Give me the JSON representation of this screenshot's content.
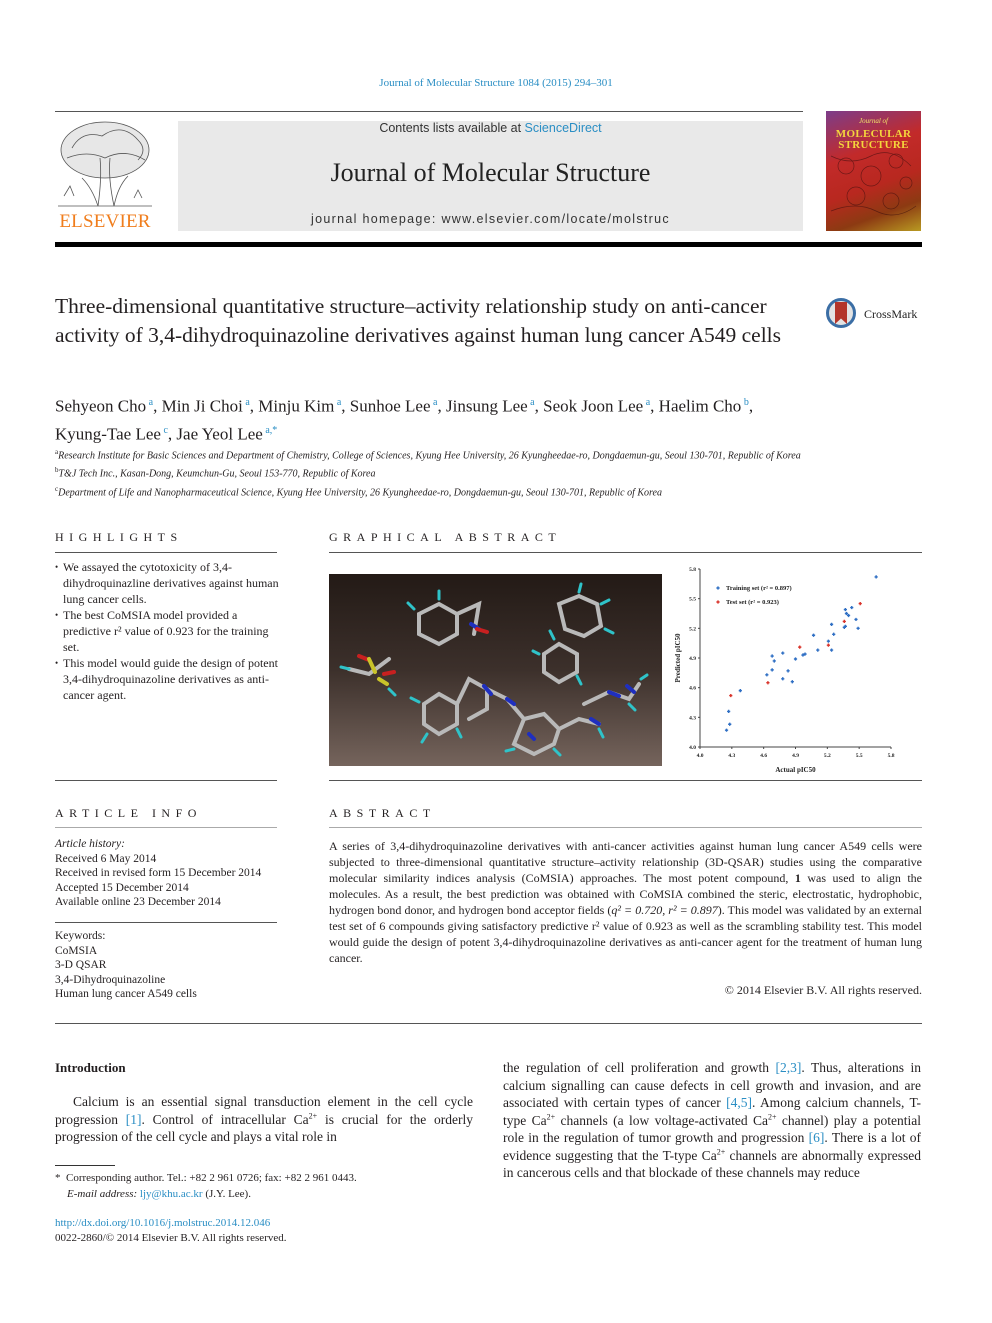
{
  "header": {
    "journal_ref": "Journal of Molecular Structure 1084 (2015) 294–301",
    "contents_prefix": "Contents lists available at ",
    "contents_link": "ScienceDirect",
    "journal_title": "Journal of Molecular Structure",
    "homepage": "journal homepage: www.elsevier.com/locate/molstruc",
    "publisher_logo": "ELSEVIER",
    "cover_line1": "Journal of",
    "cover_line2": "MOLECULAR",
    "cover_line3": "STRUCTURE"
  },
  "article": {
    "title": "Three-dimensional quantitative structure–activity relationship study on anti-cancer activity of 3,4-dihydroquinazoline derivatives against human lung cancer A549 cells",
    "crossmark_label": "CrossMark",
    "authors": [
      {
        "name": "Sehyeon Cho",
        "aff": "a"
      },
      {
        "name": "Min Ji Choi",
        "aff": "a"
      },
      {
        "name": "Minju Kim",
        "aff": "a"
      },
      {
        "name": "Sunhoe Lee",
        "aff": "a"
      },
      {
        "name": "Jinsung Lee",
        "aff": "a"
      },
      {
        "name": "Seok Joon Lee",
        "aff": "a"
      },
      {
        "name": "Haelim Cho",
        "aff": "b"
      },
      {
        "name": "Kyung-Tae Lee",
        "aff": "c"
      },
      {
        "name": "Jae Yeol Lee",
        "aff": "a,*"
      }
    ],
    "affiliations": [
      {
        "key": "a",
        "text": "Research Institute for Basic Sciences and Department of Chemistry, College of Sciences, Kyung Hee University, 26 Kyungheedae-ro, Dongdaemun-gu, Seoul 130-701, Republic of Korea"
      },
      {
        "key": "b",
        "text": "T&J Tech Inc., Kasan-Dong, Keumchun-Gu, Seoul 153-770, Republic of Korea"
      },
      {
        "key": "c",
        "text": "Department of Life and Nanopharmaceutical Science, Kyung Hee University, 26 Kyungheedae-ro, Dongdaemun-gu, Seoul 130-701, Republic of Korea"
      }
    ]
  },
  "highlights": {
    "heading": "HIGHLIGHTS",
    "items": [
      "We assayed the cytotoxicity of 3,4-dihydroquinazline derivatives against human lung cancer cells.",
      "The best CoMSIA model provided a predictive r² value of 0.923 for the training set.",
      "This model would guide the design of potent 3,4-dihydroquinazoline derivatives as anti-cancer agent."
    ]
  },
  "graphical_abstract": {
    "heading": "GRAPHICAL ABSTRACT",
    "image_alt": "3D molecular alignment of 3,4-dihydroquinazoline derivatives"
  },
  "chart_data": {
    "type": "scatter",
    "title": "",
    "xlabel": "Actual pIC50",
    "ylabel": "Predicted pIC50",
    "xlim": [
      4.0,
      5.8
    ],
    "ylim": [
      4.0,
      5.8
    ],
    "xticks": [
      "4.0",
      "4.3",
      "4.6",
      "4.9",
      "5.2",
      "5.5",
      "5.8"
    ],
    "yticks": [
      "4.0",
      "4.3",
      "4.6",
      "4.9",
      "5.2",
      "5.5",
      "5.8"
    ],
    "grid": false,
    "legend_position": "top-left",
    "series": [
      {
        "name": "Training set (r² = 0.897)",
        "color": "#2f6fc4",
        "points": [
          [
            4.25,
            4.17
          ],
          [
            4.27,
            4.36
          ],
          [
            4.28,
            4.23
          ],
          [
            4.38,
            4.57
          ],
          [
            4.63,
            4.73
          ],
          [
            4.68,
            4.78
          ],
          [
            4.68,
            4.92
          ],
          [
            4.7,
            4.87
          ],
          [
            4.78,
            4.95
          ],
          [
            4.78,
            4.69
          ],
          [
            4.83,
            4.77
          ],
          [
            4.87,
            4.66
          ],
          [
            4.9,
            4.89
          ],
          [
            4.97,
            4.93
          ],
          [
            4.99,
            4.94
          ],
          [
            5.07,
            5.13
          ],
          [
            5.11,
            4.98
          ],
          [
            5.21,
            5.07
          ],
          [
            5.24,
            4.98
          ],
          [
            5.24,
            5.24
          ],
          [
            5.26,
            5.14
          ],
          [
            5.36,
            5.21
          ],
          [
            5.37,
            5.22
          ],
          [
            5.37,
            5.39
          ],
          [
            5.38,
            5.35
          ],
          [
            5.4,
            5.33
          ],
          [
            5.43,
            5.41
          ],
          [
            5.47,
            5.29
          ],
          [
            5.49,
            5.2
          ],
          [
            5.66,
            5.72
          ]
        ]
      },
      {
        "name": "Test set (r² = 0.923)",
        "color": "#d9342b",
        "points": [
          [
            4.29,
            4.52
          ],
          [
            4.64,
            4.65
          ],
          [
            4.94,
            5.01
          ],
          [
            5.21,
            5.03
          ],
          [
            5.36,
            5.27
          ],
          [
            5.51,
            5.45
          ]
        ]
      }
    ]
  },
  "article_info": {
    "heading": "ARTICLE INFO",
    "history_label": "Article history:",
    "history": [
      "Received 6 May 2014",
      "Received in revised form 15 December 2014",
      "Accepted 15 December 2014",
      "Available online 23 December 2014"
    ],
    "keywords_label": "Keywords:",
    "keywords": [
      "CoMSIA",
      "3-D QSAR",
      "3,4-Dihydroquinazoline",
      "Human lung cancer A549 cells"
    ]
  },
  "abstract": {
    "heading": "ABSTRACT",
    "p1": "A series of 3,4-dihydroquinazoline derivatives with anti-cancer activities against human lung cancer A549 cells were subjected to three-dimensional quantitative structure–activity relationship (3D-QSAR) studies using the comparative molecular similarity indices analysis (CoMSIA) approaches. The most potent compound, ",
    "bold1": "1",
    "p2": " was used to align the molecules. As a result, the best prediction was obtained with CoMSIA combined the steric, electrostatic, hydrophobic, hydrogen bond donor, and hydrogen bond acceptor fields (",
    "q2": "q² = 0.720, r² = 0.897",
    "p3": "). This model was validated by an external test set of 6 compounds giving satisfactory predictive r² value of 0.923 as well as the scrambling stability test. This model would guide the design of potent 3,4-dihydroquinazoline derivatives as anti-cancer agent for the treatment of human lung cancer.",
    "copyright": "© 2014 Elsevier B.V. All rights reserved."
  },
  "introduction": {
    "heading": "Introduction",
    "left": {
      "t1": "Calcium is an essential signal transduction element in the cell cycle progression ",
      "r1": "[1]",
      "t2": ". Control of intracellular Ca",
      "sup1": "2+",
      "t3": " is crucial for the orderly progression of the cell cycle and plays a vital role in"
    },
    "right": {
      "t1": "the regulation of cell proliferation and growth ",
      "r1": "[2,3]",
      "t2": ". Thus, alterations in calcium signalling can cause defects in cell growth and invasion, and are associated with certain types of cancer ",
      "r2": "[4,5]",
      "t3": ". Among calcium channels, T-type Ca",
      "sup1": "2+",
      "t4": " channels (a low voltage-activated Ca",
      "sup2": "2+",
      "t5": " channel) play a potential role in the regulation of tumor growth and progression ",
      "r3": "[6]",
      "t6": ". There is a lot of evidence suggesting that the T-type Ca",
      "sup3": "2+",
      "t7": " channels are abnormally expressed in cancerous cells and that blockade of these channels may reduce"
    }
  },
  "footnote": {
    "marker": "*",
    "corresponding": "Corresponding author. Tel.: +82 2 961 0726; fax: +82 2 961 0443.",
    "email_label": "E-mail address: ",
    "email": "ljy@khu.ac.kr",
    "email_suffix": " (J.Y. Lee)."
  },
  "footer": {
    "doi": "http://dx.doi.org/10.1016/j.molstruc.2014.12.046",
    "issn": "0022-2860/© 2014 Elsevier B.V. All rights reserved."
  }
}
